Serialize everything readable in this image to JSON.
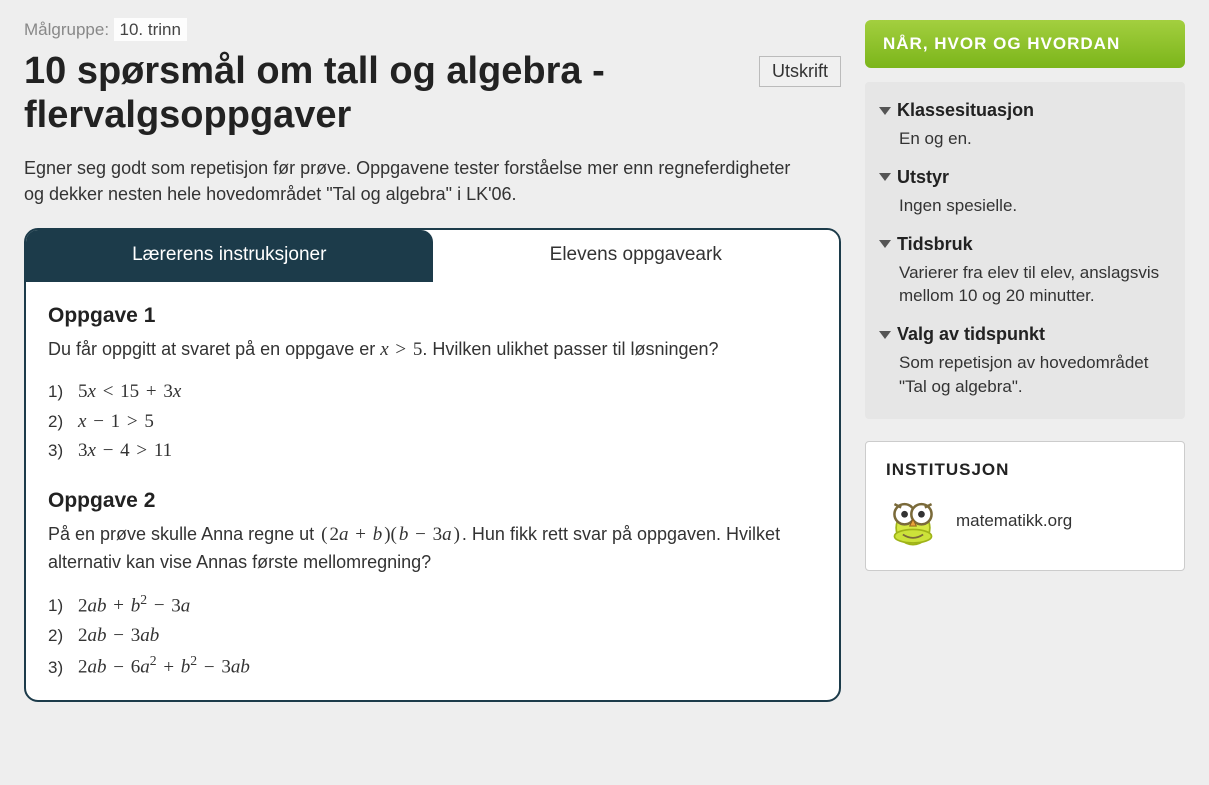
{
  "target": {
    "label": "Målgruppe:",
    "value": "10. trinn"
  },
  "title": "10 spørsmål om tall og algebra - flervalgsoppgaver",
  "print_label": "Utskrift",
  "intro": "Egner seg godt som repetisjon før prøve. Oppgavene tester forståelse mer enn regneferdigheter og dekker nesten hele hovedområdet \"Tal og algebra\" i LK'06.",
  "tabs": {
    "inactive": "Lærerens instruksjoner",
    "active": "Elevens oppgaveark"
  },
  "tasks": [
    {
      "title": "Oppgave 1",
      "text_pre": "Du får oppgitt at svaret på en oppgave er ",
      "text_math": "x > 5",
      "text_post": ". Hvilken ulikhet passer til løsningen?",
      "options": [
        "5x < 15 + 3x",
        "x − 1 > 5",
        "3x − 4 > 11"
      ]
    },
    {
      "title": "Oppgave 2",
      "text_pre": "På en prøve skulle Anna regne ut ",
      "text_math": "(2a + b)(b − 3a)",
      "text_post": ". Hun fikk rett svar på oppgaven. Hvilket alternativ kan vise Annas første mellomregning?",
      "options": [
        "2ab + b² − 3a",
        "2ab − 3ab",
        "2ab − 6a² + b² − 3ab"
      ]
    }
  ],
  "sidebar": {
    "header": "Når, hvor og hvordan",
    "items": [
      {
        "head": "Klassesituasjon",
        "body": "En og en."
      },
      {
        "head": "Utstyr",
        "body": "Ingen spesielle."
      },
      {
        "head": "Tidsbruk",
        "body": "Varierer fra elev til elev, anslagsvis mellom 10 og 20 minutter."
      },
      {
        "head": "Valg av tidspunkt",
        "body": "Som repetisjon av hovedområdet \"Tal og algebra\"."
      }
    ]
  },
  "institution": {
    "label": "Institusjon",
    "name": "matematikk.org"
  }
}
